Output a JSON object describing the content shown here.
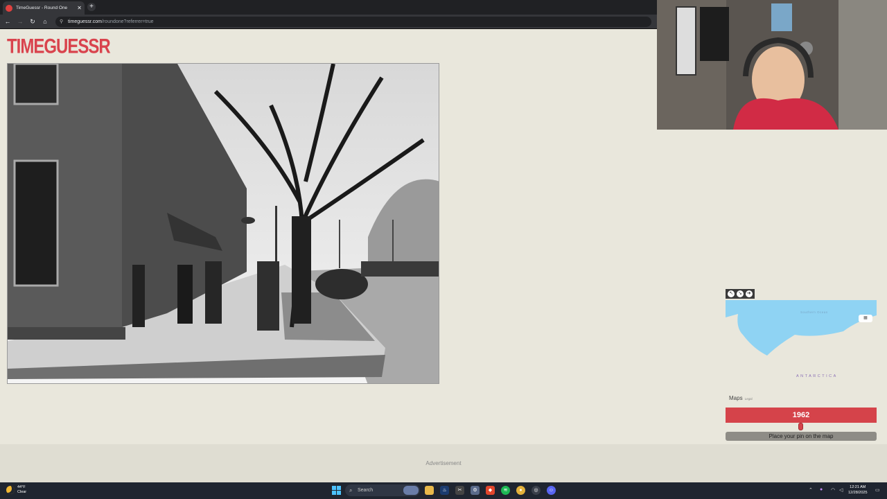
{
  "browser": {
    "tab_title": "TimeGuessr - Round One",
    "tab_close": "✕",
    "new_tab": "+",
    "url_host": "timeguessr.com",
    "url_path": "/roundone?referrer=true"
  },
  "site": {
    "logo": "TIMEGUESSR"
  },
  "map": {
    "ocean_label": "Southern Ocean",
    "region_label": "ANTARCTICA",
    "brand": "Maps",
    "legal": "Legal"
  },
  "guess": {
    "year": "1962",
    "pin_button": "Place your pin on the map"
  },
  "ad": {
    "label": "Advertisement"
  },
  "taskbar": {
    "temp": "44°F",
    "condition": "Clear",
    "search_label": "Search",
    "time": "12:21 AM",
    "date": "12/28/2025"
  },
  "colors": {
    "brand_red": "#d5434a",
    "page_bg": "#e9e7dc",
    "ocean": "#8fd3f3"
  }
}
